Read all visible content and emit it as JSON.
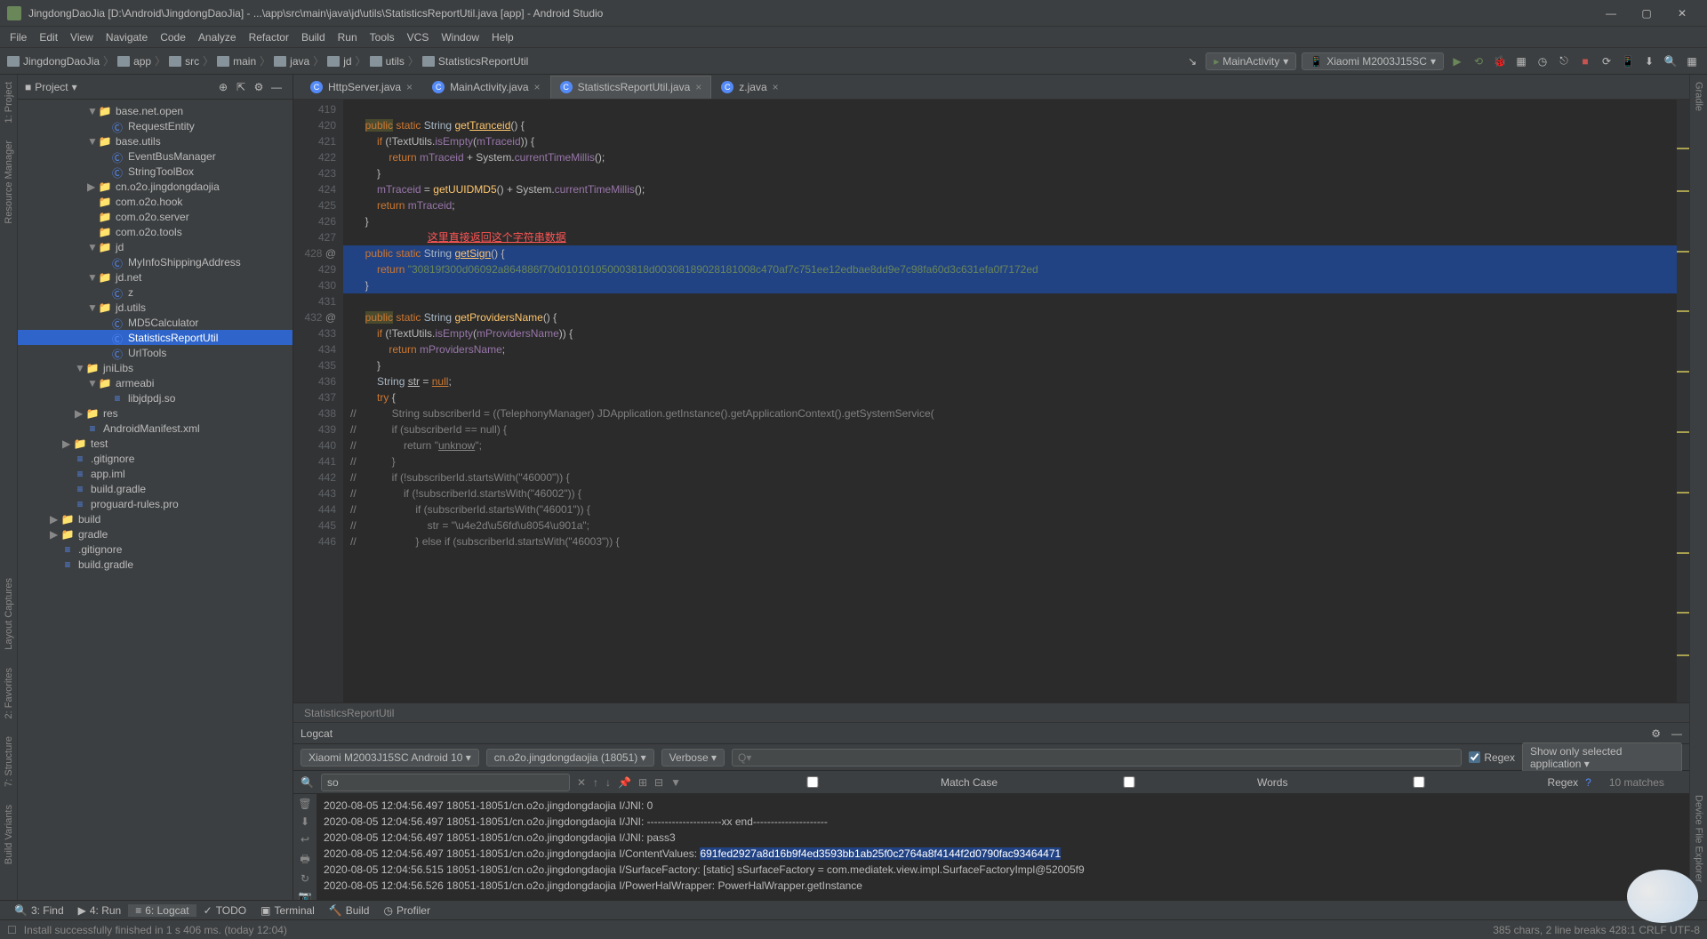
{
  "window": {
    "title": "JingdongDaoJia [D:\\Android\\JingdongDaoJia] - ...\\app\\src\\main\\java\\jd\\utils\\StatisticsReportUtil.java [app] - Android Studio"
  },
  "menu": [
    "File",
    "Edit",
    "View",
    "Navigate",
    "Code",
    "Analyze",
    "Refactor",
    "Build",
    "Run",
    "Tools",
    "VCS",
    "Window",
    "Help"
  ],
  "breadcrumbs": [
    "JingdongDaoJia",
    "app",
    "src",
    "main",
    "java",
    "jd",
    "utils",
    "StatisticsReportUtil"
  ],
  "run_config": "MainActivity",
  "device": "Xiaomi M2003J15SC",
  "project_label": "Project",
  "tree": [
    {
      "indent": 5,
      "arrow": "▼",
      "icon": "📁",
      "label": "base.net.open"
    },
    {
      "indent": 6,
      "arrow": "",
      "icon": "C",
      "label": "RequestEntity"
    },
    {
      "indent": 5,
      "arrow": "▼",
      "icon": "📁",
      "label": "base.utils"
    },
    {
      "indent": 6,
      "arrow": "",
      "icon": "C",
      "label": "EventBusManager"
    },
    {
      "indent": 6,
      "arrow": "",
      "icon": "C",
      "label": "StringToolBox"
    },
    {
      "indent": 5,
      "arrow": "▶",
      "icon": "📁",
      "label": "cn.o2o.jingdongdaojia"
    },
    {
      "indent": 5,
      "arrow": "",
      "icon": "📁",
      "label": "com.o2o.hook"
    },
    {
      "indent": 5,
      "arrow": "",
      "icon": "📁",
      "label": "com.o2o.server"
    },
    {
      "indent": 5,
      "arrow": "",
      "icon": "📁",
      "label": "com.o2o.tools"
    },
    {
      "indent": 5,
      "arrow": "▼",
      "icon": "📁",
      "label": "jd"
    },
    {
      "indent": 6,
      "arrow": "",
      "icon": "C",
      "label": "MyInfoShippingAddress"
    },
    {
      "indent": 5,
      "arrow": "▼",
      "icon": "📁",
      "label": "jd.net"
    },
    {
      "indent": 6,
      "arrow": "",
      "icon": "C",
      "label": "z"
    },
    {
      "indent": 5,
      "arrow": "▼",
      "icon": "📁",
      "label": "jd.utils"
    },
    {
      "indent": 6,
      "arrow": "",
      "icon": "C",
      "label": "MD5Calculator"
    },
    {
      "indent": 6,
      "arrow": "",
      "icon": "C",
      "label": "StatisticsReportUtil",
      "selected": true
    },
    {
      "indent": 6,
      "arrow": "",
      "icon": "C",
      "label": "UrlTools"
    },
    {
      "indent": 4,
      "arrow": "▼",
      "icon": "📁",
      "label": "jniLibs"
    },
    {
      "indent": 5,
      "arrow": "▼",
      "icon": "📁",
      "label": "armeabi"
    },
    {
      "indent": 6,
      "arrow": "",
      "icon": "≡",
      "label": "libjdpdj.so"
    },
    {
      "indent": 4,
      "arrow": "▶",
      "icon": "📁",
      "label": "res"
    },
    {
      "indent": 4,
      "arrow": "",
      "icon": "≡",
      "label": "AndroidManifest.xml"
    },
    {
      "indent": 3,
      "arrow": "▶",
      "icon": "📁",
      "label": "test"
    },
    {
      "indent": 3,
      "arrow": "",
      "icon": "≡",
      "label": ".gitignore"
    },
    {
      "indent": 3,
      "arrow": "",
      "icon": "≡",
      "label": "app.iml"
    },
    {
      "indent": 3,
      "arrow": "",
      "icon": "≡",
      "label": "build.gradle"
    },
    {
      "indent": 3,
      "arrow": "",
      "icon": "≡",
      "label": "proguard-rules.pro"
    },
    {
      "indent": 2,
      "arrow": "▶",
      "icon": "📁",
      "label": "build"
    },
    {
      "indent": 2,
      "arrow": "▶",
      "icon": "📁",
      "label": "gradle"
    },
    {
      "indent": 2,
      "arrow": "",
      "icon": "≡",
      "label": ".gitignore"
    },
    {
      "indent": 2,
      "arrow": "",
      "icon": "≡",
      "label": "build.gradle"
    }
  ],
  "tabs": [
    {
      "label": "HttpServer.java",
      "active": false
    },
    {
      "label": "MainActivity.java",
      "active": false
    },
    {
      "label": "StatisticsReportUtil.java",
      "active": true
    },
    {
      "label": "z.java",
      "active": false
    }
  ],
  "lines": {
    "start": 419,
    "end": 446
  },
  "red_annotation": "这里直接返回这个字符串数据",
  "long_string": "\"30819f300d06092a864886f70d010101050003818d00308189028181008c470af7c751ee12edbae8dd9e7c98fa60d3c631efa0f7172ed",
  "breadcrumb_bottom": "StatisticsReportUtil",
  "logcat": {
    "title": "Logcat",
    "device": "Xiaomi M2003J15SC Android 10 ▾",
    "process": "cn.o2o.jingdongdaojia (18051)",
    "level": "Verbose",
    "regex_label": "Regex",
    "filter": "Show only selected application",
    "search_value": "so",
    "match_case": "Match Case",
    "words": "Words",
    "regex": "Regex",
    "matches": "10 matches",
    "lines": [
      "2020-08-05 12:04:56.497 18051-18051/cn.o2o.jingdongdaojia I/JNI: 0",
      "2020-08-05 12:04:56.497 18051-18051/cn.o2o.jingdongdaojia I/JNI: ---------------------xx end---------------------",
      "2020-08-05 12:04:56.497 18051-18051/cn.o2o.jingdongdaojia I/JNI: pass3",
      "2020-08-05 12:04:56.497 18051-18051/cn.o2o.jingdongdaojia I/ContentValues: ",
      "2020-08-05 12:04:56.515 18051-18051/cn.o2o.jingdongdaojia I/SurfaceFactory: [static] sSurfaceFactory = com.mediatek.view.impl.SurfaceFactoryImpl@52005f9",
      "2020-08-05 12:04:56.526 18051-18051/cn.o2o.jingdongdaojia I/PowerHalWrapper: PowerHalWrapper.getInstance"
    ],
    "highlighted_value": "691fed2927a8d16b9f4ed3593bb1ab25f0c2764a8f4144f2d0790fac93464471"
  },
  "bottombar": {
    "find": "3: Find",
    "run": "4: Run",
    "logcat": "6: Logcat",
    "todo": "TODO",
    "terminal": "Terminal",
    "build": "Build",
    "profiler": "Profiler"
  },
  "status": {
    "msg": "Install successfully finished in 1 s 406 ms. (today 12:04)",
    "right": "385 chars, 2 line breaks     428:1   CRLF   UTF-8"
  },
  "side_labels": {
    "project": "1: Project",
    "resmgr": "Resource Manager",
    "layout": "Layout Captures",
    "favorites": "2: Favorites",
    "structure": "7: Structure",
    "build_v": "Build Variants",
    "gradle": "Gradle",
    "device_fe": "Device File Explorer"
  }
}
